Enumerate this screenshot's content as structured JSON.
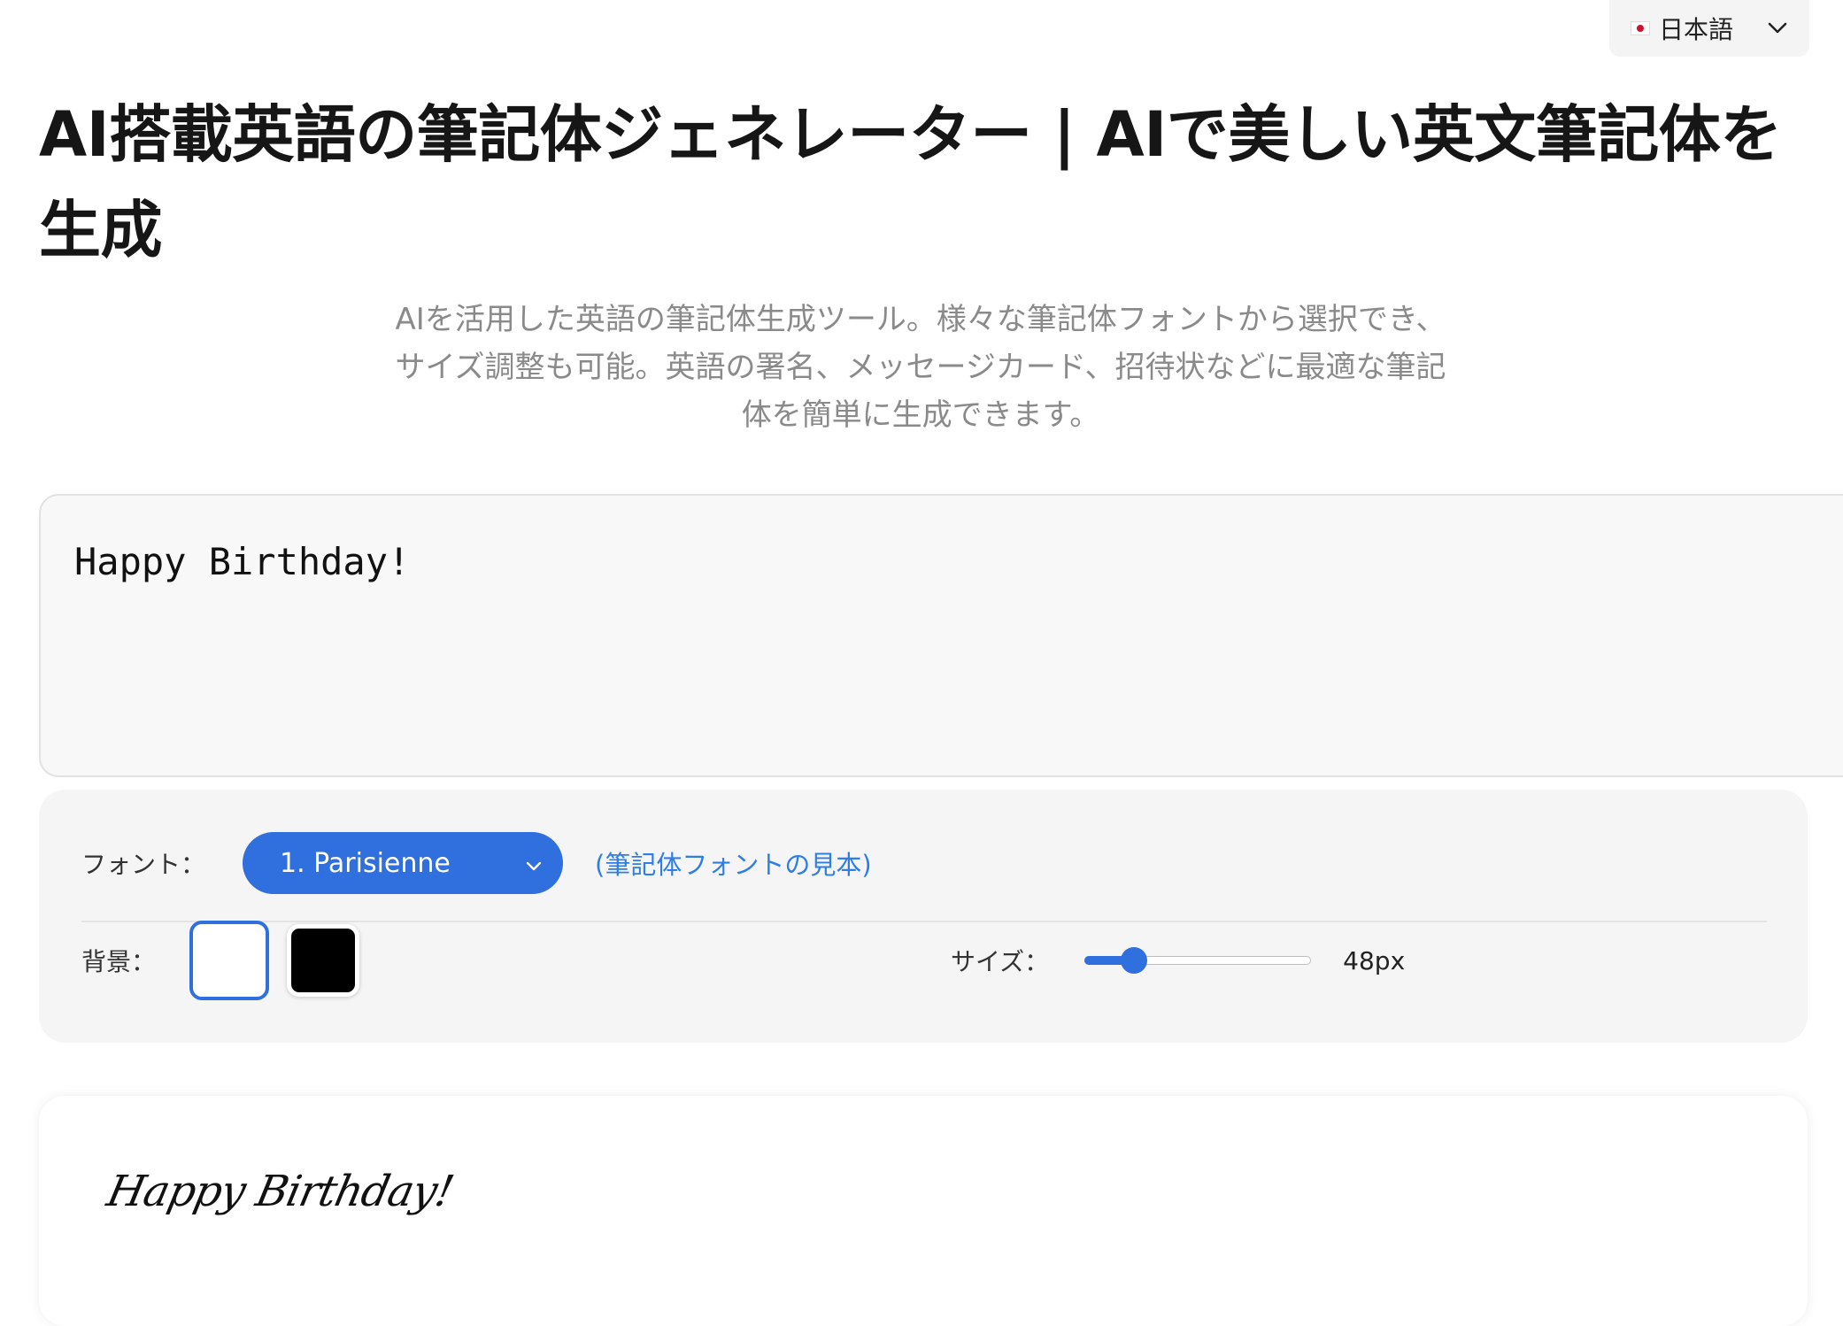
{
  "language": {
    "label": "日本語"
  },
  "page": {
    "title": "AI搭載英語の筆記体ジェネレーター | AIで美しい英文筆記体を生成",
    "description": "AIを活用した英語の筆記体生成ツール。様々な筆記体フォントから選択でき、サイズ調整も可能。英語の署名、メッセージカード、招待状などに最適な筆記体を簡単に生成できます。"
  },
  "input": {
    "value": "Happy Birthday!"
  },
  "controls": {
    "font_label": "フォント：",
    "font_selected": "1. Parisienne",
    "samples_link": "(筆記体フォントの見本)",
    "background_label": "背景：",
    "backgrounds": [
      "#ffffff",
      "#000000"
    ],
    "size_label": "サイズ：",
    "size_value": "48px",
    "size_fraction": 0.18,
    "accent_color": "#2f6fde"
  },
  "preview": {
    "text": "Happy Birthday!"
  }
}
